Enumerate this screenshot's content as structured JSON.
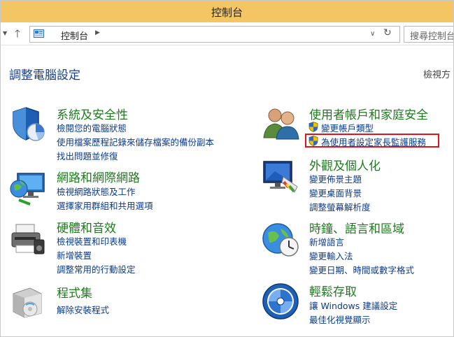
{
  "window": {
    "title": "控制台"
  },
  "address_bar": {
    "breadcrumb": "控制台",
    "search_placeholder": "搜尋控制台"
  },
  "main": {
    "heading": "調整電腦設定",
    "view_by": "檢視方"
  },
  "categories": [
    {
      "title": "系統及安全性",
      "links": [
        "檢閱您的電腦狀態",
        "使用檔案歷程記錄來儲存檔案的備份副本",
        "找出問題並修復"
      ]
    },
    {
      "title": "網路和網際網路",
      "links": [
        "檢視網路狀態及工作",
        "選擇家用群組和共用選項"
      ]
    },
    {
      "title": "硬體和音效",
      "links": [
        "檢視裝置和印表機",
        "新增裝置",
        "調整常用的行動設定"
      ]
    },
    {
      "title": "程式集",
      "links": [
        "解除安裝程式"
      ]
    },
    {
      "title": "使用者帳戶和家庭安全",
      "links": [
        "變更帳戶類型",
        "為使用者設定家長監護服務"
      ]
    },
    {
      "title": "外觀及個人化",
      "links": [
        "變更佈景主題",
        "變更桌面背景",
        "調整螢幕解析度"
      ]
    },
    {
      "title": "時鐘、語言和區域",
      "links": [
        "新增語言",
        "變更輸入法",
        "變更日期、時間或數字格式"
      ]
    },
    {
      "title": "輕鬆存取",
      "links": [
        "讓 Windows 建議設定",
        "最佳化視覺顯示"
      ]
    }
  ],
  "colors": {
    "title_bar": "#f4c663",
    "category_title": "#1d7a1d",
    "link": "#0a3a8c",
    "highlight_box": "#e0141b"
  }
}
